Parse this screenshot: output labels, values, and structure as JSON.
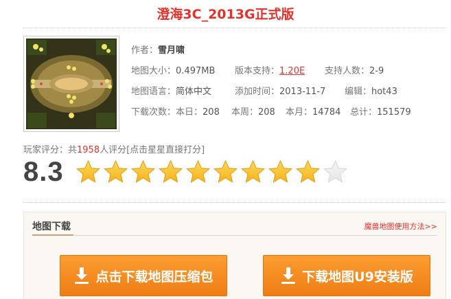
{
  "page": {
    "title": "澄海3C_2013G正式版"
  },
  "map_info": {
    "author_label": "作者：",
    "author": "雪月啸",
    "size_label": "地图大小：",
    "size": "0.497MB",
    "version_label": "版本支持：",
    "version": "1.20E",
    "players_label": "支持人数：",
    "players": "2-9",
    "language_label": "地图语言：",
    "language": "简体中文",
    "added_label": "添加时间：",
    "added": "2013-11-7",
    "editor_label": "编辑：",
    "editor": "hot43",
    "downloads_label": "下载次数：",
    "today_label": "本日：",
    "today": "208",
    "week_label": "本周：",
    "week": "208",
    "month_label": "本月：",
    "month": "14784",
    "total_label": "总计：",
    "total": "151579"
  },
  "rating": {
    "prefix": "玩家评分：共",
    "count": "1958",
    "suffix": "人评分[点击星星直接打分]",
    "score": "8.3",
    "stars_total": 10,
    "stars_filled": 9,
    "star_color": "#f6b21c",
    "star_empty_color": "#e6e6e6"
  },
  "download": {
    "section_title": "地图下载",
    "help_link": "魔兽地图使用方法>>",
    "btn_zip": "点击下载地图压缩包",
    "btn_u9": "下载地图U9安装版",
    "accent": "#f58a1f"
  }
}
